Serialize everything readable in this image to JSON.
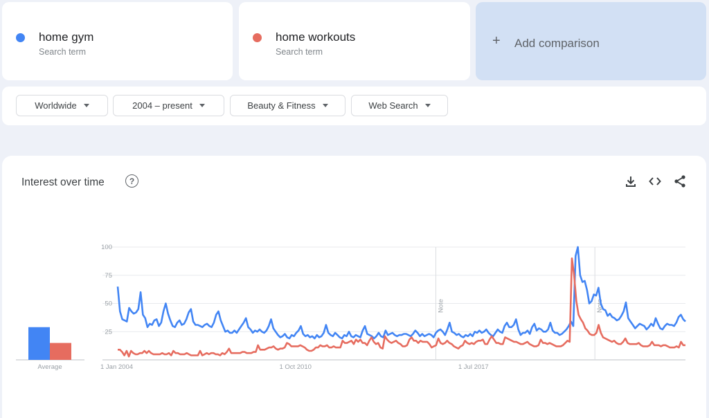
{
  "terms": [
    {
      "name": "home gym",
      "subtitle": "Search term",
      "color": "#4285f4"
    },
    {
      "name": "home workouts",
      "subtitle": "Search term",
      "color": "#e66c5f"
    }
  ],
  "add_comparison": {
    "icon": "plus-icon",
    "label": "Add comparison"
  },
  "filters": [
    {
      "label": "Worldwide"
    },
    {
      "label": "2004 – present"
    },
    {
      "label": "Beauty & Fitness"
    },
    {
      "label": "Web Search"
    }
  ],
  "panel": {
    "title": "Interest over time",
    "help_icon": "help-circle-icon",
    "tools": [
      "download-icon",
      "embed-code-icon",
      "share-icon"
    ]
  },
  "chart_data": {
    "type": "line",
    "title": "Interest over time",
    "xlabel": "",
    "ylabel": "",
    "ylim": [
      0,
      100
    ],
    "yticks": [
      25,
      50,
      75,
      100
    ],
    "x_tick_labels": [
      "1 Jan 2004",
      "1 Oct 2010",
      "1 Jul 2017"
    ],
    "x_range": [
      "2004-01",
      "2025-06"
    ],
    "grid": true,
    "notes": [
      {
        "label": "Note",
        "date": "2016-01"
      },
      {
        "label": "Note",
        "date": "2022-01"
      }
    ],
    "average": {
      "label": "Average",
      "values": [
        {
          "name": "home gym",
          "value": 29
        },
        {
          "name": "home workouts",
          "value": 15
        }
      ]
    },
    "series": [
      {
        "name": "home gym",
        "color": "#4285f4",
        "values": [
          65,
          43,
          36,
          35,
          34,
          46,
          43,
          41,
          42,
          45,
          60,
          40,
          37,
          29,
          32,
          31,
          35,
          36,
          30,
          33,
          43,
          50,
          41,
          35,
          30,
          29,
          33,
          35,
          31,
          32,
          36,
          42,
          45,
          34,
          31,
          31,
          30,
          29,
          31,
          32,
          30,
          29,
          33,
          40,
          43,
          35,
          30,
          25,
          26,
          24,
          24,
          26,
          24,
          27,
          30,
          33,
          37,
          29,
          27,
          24,
          26,
          25,
          27,
          25,
          24,
          26,
          30,
          36,
          28,
          25,
          22,
          20,
          21,
          23,
          20,
          19,
          22,
          21,
          24,
          26,
          30,
          23,
          21,
          22,
          20,
          21,
          19,
          22,
          20,
          21,
          24,
          31,
          24,
          22,
          21,
          24,
          22,
          20,
          19,
          22,
          21,
          25,
          21,
          20,
          22,
          21,
          20,
          26,
          30,
          23,
          22,
          21,
          19,
          21,
          24,
          21,
          20,
          26,
          22,
          23,
          24,
          22,
          21,
          22,
          22,
          23,
          23,
          22,
          21,
          23,
          26,
          24,
          21,
          23,
          21,
          22,
          23,
          22,
          20,
          24,
          26,
          27,
          25,
          22,
          27,
          33,
          25,
          24,
          22,
          23,
          21,
          20,
          22,
          21,
          23,
          21,
          25,
          24,
          26,
          24,
          25,
          27,
          24,
          22,
          21,
          24,
          27,
          25,
          24,
          30,
          33,
          29,
          29,
          31,
          36,
          27,
          22,
          24,
          24,
          26,
          23,
          29,
          32,
          26,
          28,
          27,
          25,
          25,
          27,
          33,
          26,
          24,
          24,
          22,
          23,
          25,
          27,
          30,
          34,
          30,
          92,
          100,
          75,
          69,
          70,
          62,
          50,
          52,
          58,
          57,
          64,
          50,
          45,
          44,
          39,
          41,
          38,
          37,
          35,
          36,
          39,
          43,
          51,
          37,
          34,
          31,
          28,
          30,
          32,
          31,
          30,
          27,
          29,
          32,
          30,
          37,
          32,
          28,
          27,
          30,
          32,
          31,
          31,
          30,
          33,
          38,
          40,
          36,
          34
        ]
      },
      {
        "name": "home workouts",
        "color": "#e66c5f",
        "values": [
          9,
          9,
          7,
          4,
          8,
          3,
          8,
          6,
          5,
          5,
          6,
          6,
          8,
          6,
          8,
          6,
          5,
          5,
          5,
          5,
          6,
          5,
          5,
          6,
          4,
          8,
          6,
          6,
          5,
          5,
          5,
          6,
          5,
          4,
          4,
          4,
          4,
          8,
          4,
          5,
          6,
          5,
          6,
          6,
          5,
          5,
          4,
          6,
          5,
          7,
          10,
          6,
          6,
          6,
          6,
          6,
          7,
          7,
          6,
          6,
          6,
          7,
          7,
          13,
          9,
          9,
          9,
          10,
          11,
          11,
          12,
          10,
          9,
          10,
          10,
          11,
          15,
          14,
          12,
          12,
          12,
          12,
          13,
          12,
          11,
          9,
          8,
          8,
          9,
          11,
          11,
          13,
          12,
          12,
          13,
          11,
          11,
          12,
          11,
          11,
          11,
          17,
          15,
          15,
          16,
          17,
          14,
          18,
          16,
          18,
          15,
          15,
          13,
          17,
          20,
          16,
          14,
          15,
          11,
          10,
          21,
          18,
          16,
          15,
          16,
          17,
          15,
          14,
          12,
          12,
          13,
          18,
          20,
          17,
          17,
          15,
          17,
          16,
          16,
          16,
          14,
          11,
          12,
          13,
          19,
          15,
          14,
          15,
          17,
          15,
          14,
          12,
          11,
          10,
          12,
          13,
          17,
          15,
          14,
          15,
          14,
          16,
          17,
          17,
          18,
          14,
          14,
          18,
          21,
          18,
          15,
          15,
          14,
          14,
          20,
          19,
          18,
          17,
          16,
          16,
          15,
          14,
          14,
          15,
          16,
          14,
          13,
          12,
          12,
          13,
          18,
          15,
          15,
          14,
          15,
          14,
          13,
          12,
          12,
          12,
          13,
          15,
          17,
          16,
          90,
          75,
          52,
          40,
          36,
          33,
          28,
          26,
          23,
          22,
          22,
          24,
          31,
          24,
          20,
          19,
          18,
          17,
          16,
          17,
          15,
          14,
          14,
          16,
          19,
          15,
          14,
          14,
          14,
          14,
          15,
          13,
          12,
          12,
          12,
          13,
          16,
          13,
          13,
          13,
          12,
          13,
          13,
          12,
          11,
          11,
          11,
          12,
          11,
          16,
          13,
          13
        ]
      }
    ]
  }
}
